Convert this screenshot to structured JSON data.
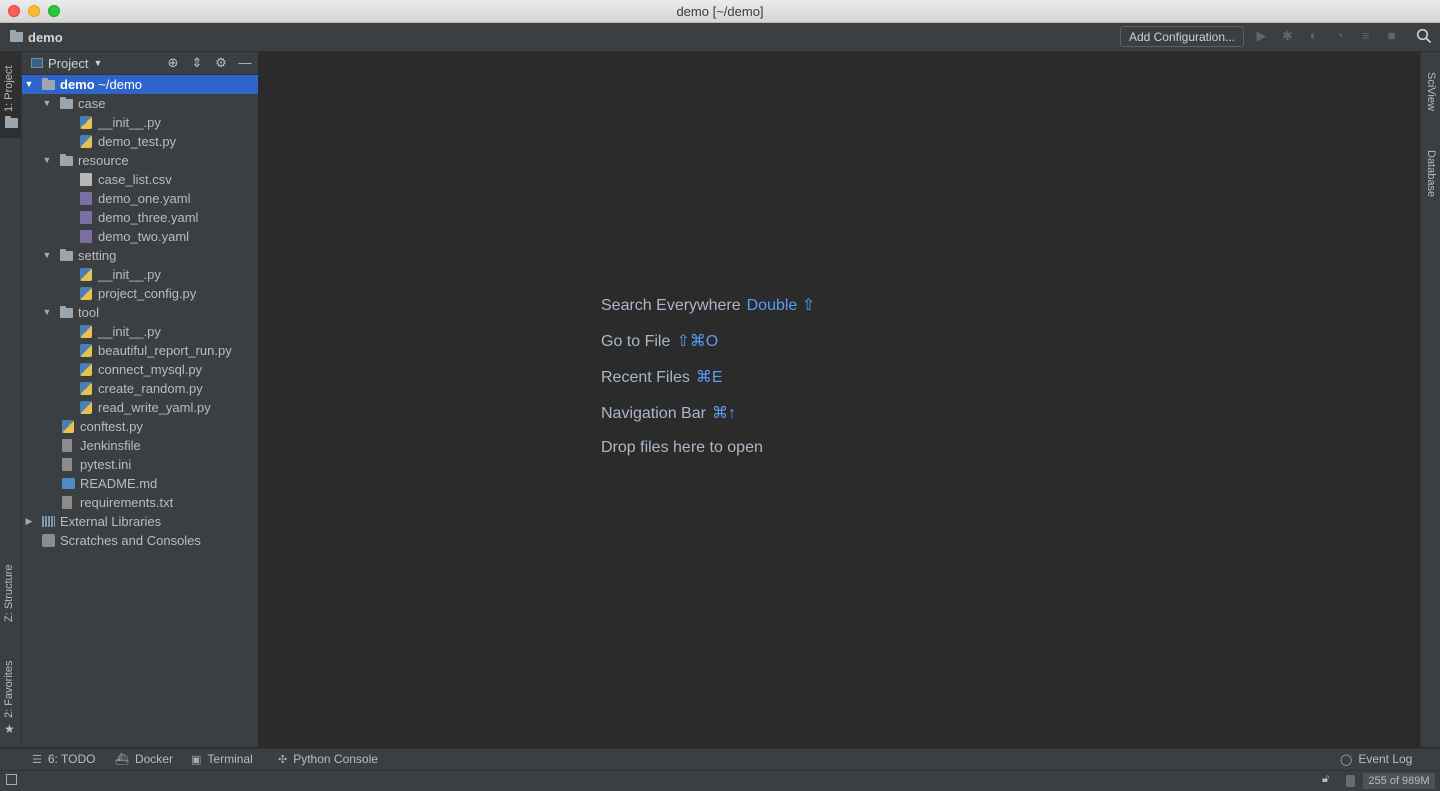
{
  "window": {
    "title": "demo [~/demo]"
  },
  "navbar": {
    "project_name": "demo",
    "add_configuration": "Add Configuration..."
  },
  "left_tabs": {
    "project": "1: Project",
    "structure": "Z: Structure",
    "favorites": "2: Favorites"
  },
  "right_tabs": {
    "sciview": "SciView",
    "database": "Database"
  },
  "project_panel": {
    "selector": "Project",
    "tree": [
      {
        "depth": 0,
        "arrow": "▼",
        "icon": "folder-icon",
        "name": "demo",
        "suffix": " ~/demo",
        "selected": true
      },
      {
        "depth": 1,
        "arrow": "▼",
        "icon": "folder-icon",
        "name": "case"
      },
      {
        "depth": 2,
        "arrow": "",
        "icon": "python-file-icon",
        "name": "__init__.py"
      },
      {
        "depth": 2,
        "arrow": "",
        "icon": "python-file-icon",
        "name": "demo_test.py"
      },
      {
        "depth": 1,
        "arrow": "▼",
        "icon": "folder-icon",
        "name": "resource"
      },
      {
        "depth": 2,
        "arrow": "",
        "icon": "csv-file-icon",
        "name": "case_list.csv"
      },
      {
        "depth": 2,
        "arrow": "",
        "icon": "yaml-file-icon",
        "name": "demo_one.yaml"
      },
      {
        "depth": 2,
        "arrow": "",
        "icon": "yaml-file-icon",
        "name": "demo_three.yaml"
      },
      {
        "depth": 2,
        "arrow": "",
        "icon": "yaml-file-icon",
        "name": "demo_two.yaml"
      },
      {
        "depth": 1,
        "arrow": "▼",
        "icon": "folder-icon",
        "name": "setting"
      },
      {
        "depth": 2,
        "arrow": "",
        "icon": "python-file-icon",
        "name": "__init__.py"
      },
      {
        "depth": 2,
        "arrow": "",
        "icon": "python-file-icon",
        "name": "project_config.py"
      },
      {
        "depth": 1,
        "arrow": "▼",
        "icon": "folder-icon",
        "name": "tool"
      },
      {
        "depth": 2,
        "arrow": "",
        "icon": "python-file-icon",
        "name": "__init__.py"
      },
      {
        "depth": 2,
        "arrow": "",
        "icon": "python-file-icon",
        "name": "beautiful_report_run.py"
      },
      {
        "depth": 2,
        "arrow": "",
        "icon": "python-file-icon",
        "name": "connect_mysql.py"
      },
      {
        "depth": 2,
        "arrow": "",
        "icon": "python-file-icon",
        "name": "create_random.py"
      },
      {
        "depth": 2,
        "arrow": "",
        "icon": "python-file-icon",
        "name": "read_write_yaml.py"
      },
      {
        "depth": 1,
        "arrow": "",
        "icon": "python-file-icon",
        "name": "conftest.py"
      },
      {
        "depth": 1,
        "arrow": "",
        "icon": "text-file-icon",
        "name": "Jenkinsfile"
      },
      {
        "depth": 1,
        "arrow": "",
        "icon": "ini-file-icon",
        "name": "pytest.ini"
      },
      {
        "depth": 1,
        "arrow": "",
        "icon": "markdown-file-icon",
        "name": "README.md"
      },
      {
        "depth": 1,
        "arrow": "",
        "icon": "text-file-icon",
        "name": "requirements.txt"
      },
      {
        "depth": 0,
        "arrow": "▶",
        "icon": "library-icon",
        "name": "External Libraries"
      },
      {
        "depth": 0,
        "arrow": "",
        "icon": "scratches-icon",
        "name": "Scratches and Consoles"
      }
    ]
  },
  "editor": {
    "hints": [
      {
        "label": "Search Everywhere",
        "key": "Double ⇧"
      },
      {
        "label": "Go to File",
        "key": "⇧⌘O"
      },
      {
        "label": "Recent Files",
        "key": "⌘E"
      },
      {
        "label": "Navigation Bar",
        "key": "⌘↑"
      },
      {
        "label": "Drop files here to open",
        "key": ""
      }
    ]
  },
  "bottom_tabs": {
    "todo": "6: TODO",
    "docker": "Docker",
    "terminal": "Terminal",
    "python_console": "Python Console",
    "event_log": "Event Log"
  },
  "status": {
    "memory": "255 of 989M"
  }
}
